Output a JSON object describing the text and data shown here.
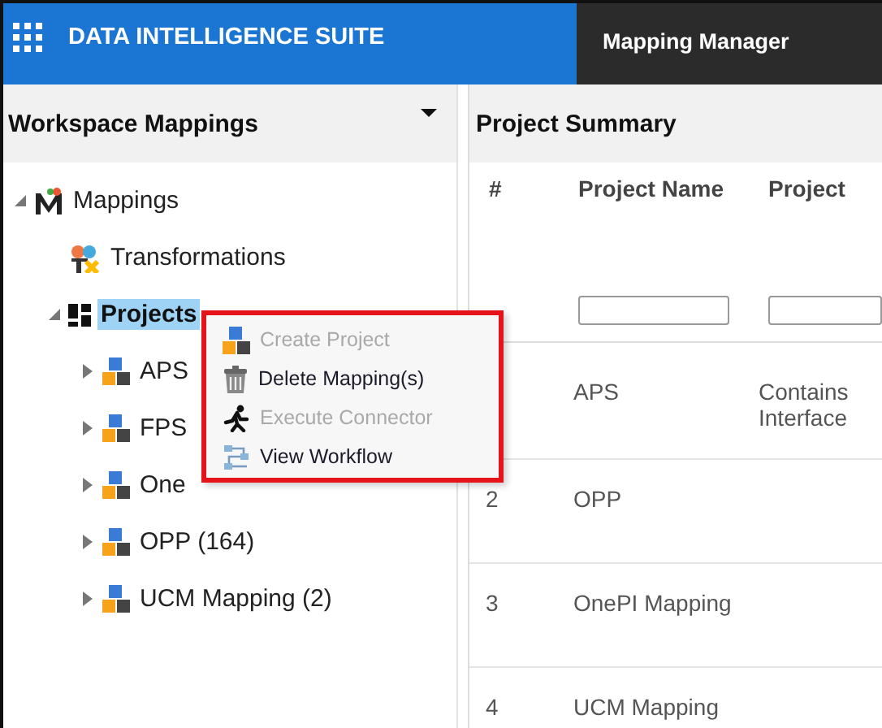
{
  "header": {
    "app_title": "DATA INTELLIGENCE SUITE",
    "tab": "Mapping Manager"
  },
  "left_panel": {
    "title": "Workspace Mappings",
    "tree": [
      {
        "label": "Mappings",
        "kind": "mappings",
        "expanded": true,
        "selected": false,
        "children": [
          {
            "label": "Transformations",
            "kind": "transformations",
            "selected": false
          },
          {
            "label": "Projects",
            "kind": "projects",
            "expanded": true,
            "selected": true,
            "children": [
              {
                "label": "APS",
                "kind": "project",
                "expanded": false,
                "selected": false
              },
              {
                "label": "FPS",
                "kind": "project",
                "expanded": false,
                "selected": false
              },
              {
                "label": "One",
                "kind": "project",
                "expanded": false,
                "selected": false
              },
              {
                "label": "OPP (164)",
                "kind": "project",
                "expanded": false,
                "selected": false
              },
              {
                "label": "UCM Mapping (2)",
                "kind": "project",
                "expanded": false,
                "selected": false
              }
            ]
          }
        ]
      }
    ]
  },
  "context_menu": [
    {
      "label": "Create Project",
      "kind": "create",
      "disabled": true
    },
    {
      "label": "Delete Mapping(s)",
      "kind": "delete",
      "disabled": false
    },
    {
      "label": "Execute Connector",
      "kind": "execute",
      "disabled": true
    },
    {
      "label": "View Workflow",
      "kind": "workflow",
      "disabled": false
    }
  ],
  "right_panel": {
    "title": "Project Summary",
    "table": {
      "columns": [
        "#",
        "Project Name",
        "Project"
      ],
      "rows": [
        {
          "number": "",
          "name": "APS",
          "description": "Contains\nInterface"
        },
        {
          "number": "2",
          "name": "OPP",
          "description": ""
        },
        {
          "number": "3",
          "name": "OnePI Mapping",
          "description": ""
        },
        {
          "number": "4",
          "name": "UCM Mapping",
          "description": ""
        }
      ]
    }
  }
}
